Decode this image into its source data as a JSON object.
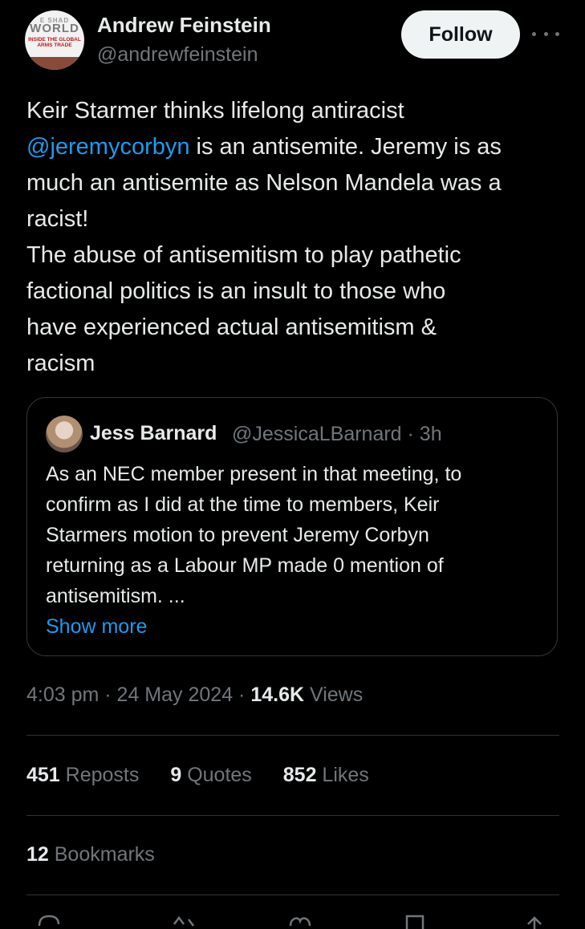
{
  "author": {
    "name": "Andrew Feinstein",
    "handle": "@andrewfeinstein",
    "avatar_lines": [
      "E SHAD",
      "WORLD",
      "INSIDE THE GLOBAL",
      "ARMS TRADE"
    ]
  },
  "follow_label": "Follow",
  "tweet": {
    "line1": "Keir Starmer thinks lifelong antiracist",
    "mention": "@jeremycorbyn",
    "line2_rest": " is an antisemite. Jeremy is as",
    "line3": "much an antisemite as Nelson Mandela was a",
    "line4": "racist!",
    "line5": "The abuse of antisemitism to play pathetic",
    "line6": "factional politics is  an insult to those who",
    "line7": "have experienced actual antisemitism &",
    "line8": "racism"
  },
  "quote": {
    "name": "Jess Barnard",
    "handle_time": "@JessicaLBarnard · 3h",
    "lines": [
      "As an NEC member present in that meeting, to",
      "confirm as I did at the time to members, Keir",
      "Starmers motion to prevent Jeremy Corbyn",
      "returning as a Labour MP made 0 mention of",
      "antisemitism. ..."
    ],
    "show_more": "Show more"
  },
  "meta": {
    "time_date": "4:03 pm · 24 May 2024 · ",
    "views_count": "14.6K",
    "views_label": " Views"
  },
  "stats": {
    "reposts_count": "451",
    "reposts_label": " Reposts",
    "quotes_count": "9",
    "quotes_label": " Quotes",
    "likes_count": "852",
    "likes_label": " Likes"
  },
  "bookmarks": {
    "count": "12",
    "label": " Bookmarks"
  },
  "colors": {
    "accent": "#1d9bf0",
    "muted": "#71767b",
    "text": "#e7e9ea",
    "background": "#000000"
  },
  "action_icons": [
    "reply-icon",
    "repost-icon",
    "like-icon",
    "bookmark-icon",
    "share-icon"
  ]
}
